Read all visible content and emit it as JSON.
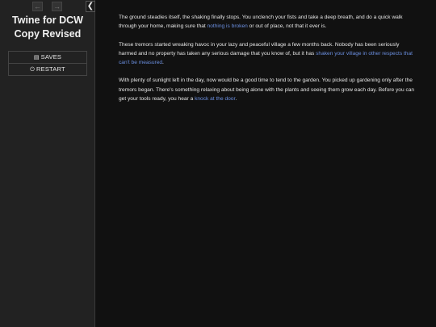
{
  "history": {
    "back_icon": "arrow-left-icon",
    "forward_icon": "arrow-right-icon"
  },
  "sidebar": {
    "stow_icon": "chevron-left-icon",
    "title_line1": "Twine for DCW",
    "title_line2": "Copy Revised",
    "menu": [
      {
        "label": "SAVES",
        "icon": "saves-icon"
      },
      {
        "label": "RESTART",
        "icon": "restart-icon"
      }
    ]
  },
  "passage": {
    "p1": {
      "before": "The ground steadies itself, the shaking finally stops. You unclench your fists and take a deep breath, and do a quick walk through your home, making sure that ",
      "link": "nothing is broken",
      "after": " or out of place, not that it ever is."
    },
    "p2": {
      "before": "These tremors started wreaking havoc in your lazy and peaceful village a few months back. Nobody has been seriously harmed and no property has taken any serious damage that you know of, but it has ",
      "link": "shaken your village in other respects that can't be measured",
      "after": "."
    },
    "p3": {
      "before": "With plenty of sunlight left in the day, now would be a good time to tend to the garden. You picked up gardening only after the tremors began. There's something relaxing about being alone with the plants and seeing them grow each day. Before you can get your tools ready, you hear a ",
      "link": "knock at the door",
      "after": "."
    }
  }
}
